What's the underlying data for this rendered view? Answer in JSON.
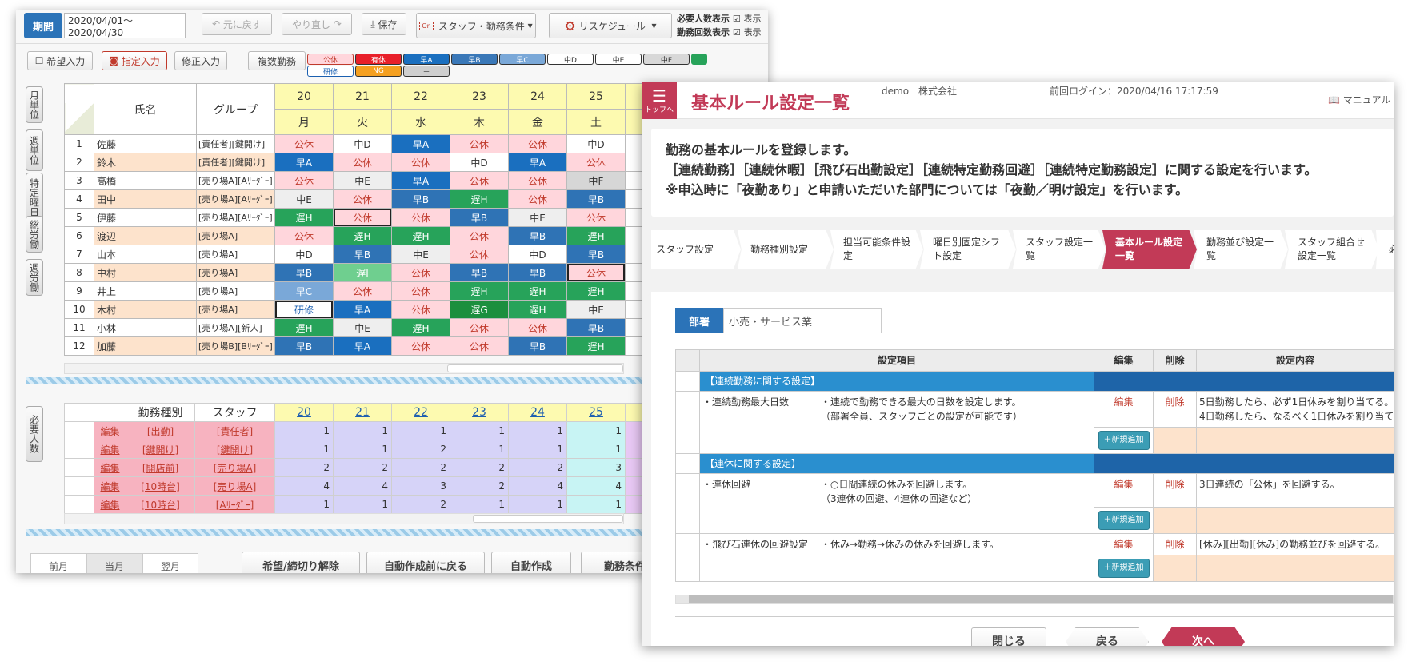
{
  "left": {
    "toolbar": {
      "period_label": "期間",
      "period_value": "2020/04/01～2020/04/30",
      "undo": "元に戻す",
      "redo": "やり直し",
      "save": "保存",
      "staff_cond": "スタッフ・勤務条件",
      "reschedule": "リスケジュール",
      "req_label": "必要人数表示",
      "req_sub": "表示",
      "cnt_label": "勤務回数表示",
      "cnt_sub": "表示"
    },
    "modes": {
      "hope": "希望入力",
      "assign": "指定入力",
      "fix": "修正入力",
      "multi": "複数勤務"
    },
    "chips": [
      {
        "label": "公休",
        "bg": "#ffd6dc",
        "color": "#c0392b"
      },
      {
        "label": "有休",
        "bg": "#e8202a",
        "color": "#fff"
      },
      {
        "label": "早A",
        "bg": "#1a6fbf",
        "color": "#fff"
      },
      {
        "label": "早B",
        "bg": "#3a78b8",
        "color": "#fff"
      },
      {
        "label": "早C",
        "bg": "#7aa8d8",
        "color": "#fff"
      },
      {
        "label": "中D",
        "bg": "#fff",
        "color": "#333"
      },
      {
        "label": "中E",
        "bg": "#fff",
        "color": "#333"
      },
      {
        "label": "中F",
        "bg": "#d8d8d8",
        "color": "#333"
      },
      {
        "label": "研修",
        "bg": "#fff",
        "color": "#1a5fb0"
      },
      {
        "label": "NG",
        "bg": "#f5a020",
        "color": "#fff"
      },
      {
        "label": "－",
        "bg": "#cfcfcf",
        "color": "#333"
      }
    ],
    "side_tabs": [
      "月単位",
      "週単位",
      "特定曜日",
      "総労働",
      "週労働"
    ],
    "side_req": "必要人数",
    "grid_head": {
      "name": "氏名",
      "group": "グループ",
      "days": [
        "20",
        "21",
        "22",
        "23",
        "24",
        "25"
      ],
      "weekdays": [
        "月",
        "火",
        "水",
        "木",
        "金",
        "土"
      ]
    },
    "staff": [
      {
        "no": "1",
        "name": "佐藤",
        "group": "[責任者][鍵開け]",
        "shifts": [
          "公休",
          "中D",
          "早A",
          "公休",
          "公休",
          "中D"
        ]
      },
      {
        "no": "2",
        "name": "鈴木",
        "group": "[責任者][鍵開け]",
        "shifts": [
          "早A",
          "公休",
          "公休",
          "中D",
          "早A",
          "公休"
        ]
      },
      {
        "no": "3",
        "name": "高橋",
        "group": "[売り場A][Aﾘｰﾀﾞｰ]",
        "shifts": [
          "公休",
          "中E",
          "早A",
          "公休",
          "公休",
          "中F"
        ]
      },
      {
        "no": "4",
        "name": "田中",
        "group": "[売り場A][Aﾘｰﾀﾞｰ]",
        "shifts": [
          "中E",
          "公休",
          "早B",
          "遅H",
          "公休",
          "早B"
        ]
      },
      {
        "no": "5",
        "name": "伊藤",
        "group": "[売り場A][Aﾘｰﾀﾞｰ]",
        "shifts": [
          "遅H",
          "公休",
          "公休",
          "早B",
          "中E",
          "公休"
        ]
      },
      {
        "no": "6",
        "name": "渡辺",
        "group": "[売り場A]",
        "shifts": [
          "公休",
          "遅H",
          "遅H",
          "公休",
          "早B",
          "遅H"
        ]
      },
      {
        "no": "7",
        "name": "山本",
        "group": "[売り場A]",
        "shifts": [
          "中D",
          "早B",
          "中E",
          "公休",
          "中D",
          "早B"
        ]
      },
      {
        "no": "8",
        "name": "中村",
        "group": "[売り場A]",
        "shifts": [
          "早B",
          "遅I",
          "公休",
          "早B",
          "早B",
          "公休"
        ]
      },
      {
        "no": "9",
        "name": "井上",
        "group": "[売り場A]",
        "shifts": [
          "早C",
          "公休",
          "公休",
          "遅H",
          "遅H",
          "遅H"
        ]
      },
      {
        "no": "10",
        "name": "木村",
        "group": "[売り場A]",
        "shifts": [
          "研修",
          "早A",
          "公休",
          "遅G",
          "遅H",
          "中E"
        ]
      },
      {
        "no": "11",
        "name": "小林",
        "group": "[売り場A][新人]",
        "shifts": [
          "遅H",
          "中E",
          "遅H",
          "公休",
          "公休",
          "早B"
        ]
      },
      {
        "no": "12",
        "name": "加藤",
        "group": "[売り場B][Bﾘｰﾀﾞｰ]",
        "shifts": [
          "早B",
          "早A",
          "公休",
          "公休",
          "早B",
          "遅H"
        ]
      }
    ],
    "req_head": {
      "type": "勤務種別",
      "staff": "スタッフ",
      "days": [
        "20",
        "21",
        "22",
        "23",
        "24",
        "25"
      ]
    },
    "req_rows": [
      {
        "edit": "編集",
        "type": "[出勤]",
        "staff": "[責任者]",
        "vals": [
          "1",
          "1",
          "1",
          "1",
          "1",
          "1"
        ]
      },
      {
        "edit": "編集",
        "type": "[鍵開け]",
        "staff": "[鍵開け]",
        "vals": [
          "1",
          "1",
          "2",
          "1",
          "1",
          "1"
        ]
      },
      {
        "edit": "編集",
        "type": "[開店前]",
        "staff": "[売り場A]",
        "vals": [
          "2",
          "2",
          "2",
          "2",
          "2",
          "3"
        ]
      },
      {
        "edit": "編集",
        "type": "[10時台]",
        "staff": "[売り場A]",
        "vals": [
          "4",
          "4",
          "3",
          "2",
          "4",
          "4"
        ]
      },
      {
        "edit": "編集",
        "type": "[10時台]",
        "staff": "[Aﾘｰﾀﾞｰ]",
        "vals": [
          "1",
          "1",
          "2",
          "1",
          "1",
          "1"
        ]
      }
    ],
    "month_tabs": [
      "前月",
      "当月",
      "翌月"
    ],
    "bottom_btns": [
      "希望/締切り解除",
      "自動作成前に戻る",
      "自動作成",
      "勤務条件"
    ]
  },
  "right": {
    "menu_caption": "トップへ",
    "title": "基本ルール設定一覧",
    "user": "demo　株式会社",
    "last_login": "前回ログイン：2020/04/16 17:17:59",
    "manual": "マニュアル",
    "desc1": "勤務の基本ルールを登録します。",
    "desc2": "［連続勤務］［連続休暇］［飛び石出勤設定］［連続特定勤務回避］［連続特定勤務設定］に関する設定を行います。",
    "desc3": "※申込時に「夜勤あり」と申請いただいた部門については「夜勤／明け設定」を行います。",
    "crumbs": [
      "スタッフ設定",
      "勤務種別設定",
      "担当可能条件設定",
      "曜日別固定シフト設定",
      "スタッフ設定一覧",
      "基本ルール設定一覧",
      "勤務並び設定一覧",
      "スタッフ組合せ設定一覧",
      "必"
    ],
    "dept_label": "部署",
    "dept_value": "小売・サービス業",
    "th": {
      "item": "設定項目",
      "edit": "編集",
      "del": "削除",
      "content": "設定内容"
    },
    "sections": [
      {
        "title": "【連続勤務に関する設定】",
        "rows": [
          {
            "name": "・連続勤務最大日数",
            "desc": [
              "・連続で勤務できる最大の日数を設定します。",
              "（部署全員、スタッフごとの設定が可能です）"
            ],
            "edit": "編集",
            "del": "削除",
            "content": [
              "5日勤務したら、必ず1日休みを割り当てる。",
              "4日勤務したら、なるべく1日休みを割り当て"
            ],
            "add": "＋新規追加"
          }
        ]
      },
      {
        "title": "【連休に関する設定】",
        "rows": [
          {
            "name": "・連休回避",
            "desc": [
              "・○日間連続の休みを回避します。",
              "（3連休の回避、4連休の回避など）"
            ],
            "edit": "編集",
            "del": "削除",
            "content": [
              "3日連続の「公休」を回避する。"
            ],
            "add": "＋新規追加"
          },
          {
            "name": "・飛び石連休の回避設定",
            "desc": [
              "・休み→勤務→休みの休みを回避します。"
            ],
            "edit": "編集",
            "del": "削除",
            "content": [
              "[休み][出勤][休み]の勤務並びを回避する。"
            ],
            "add": "＋新規追加"
          }
        ]
      }
    ],
    "footer_btns": [
      "閉じる",
      "戻る",
      "次へ"
    ],
    "accent": "#c23a57"
  }
}
